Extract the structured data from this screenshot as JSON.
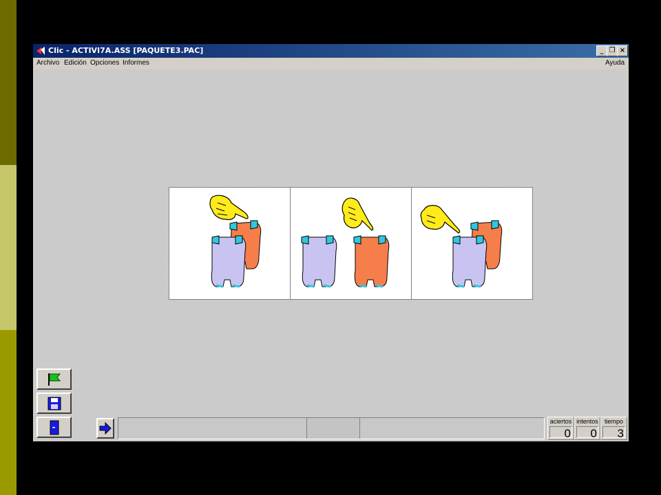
{
  "window": {
    "title": "Clic - ACTIVI7A.ASS [PAQUETE3.PAC]",
    "controls": {
      "minimize": "_",
      "maximize": "❐",
      "close": "×"
    }
  },
  "menu": {
    "items": [
      "Archivo",
      "Edición",
      "Opciones",
      "Informes"
    ],
    "help": "Ayuda"
  },
  "activity": {
    "panels": [
      {
        "image": "hand-pointing-orange-elephant-behind-purple"
      },
      {
        "image": "hand-pointing-between-purple-and-orange-elephants"
      },
      {
        "image": "hand-pointing-purple-elephant-in-front-of-orange"
      }
    ]
  },
  "side_buttons": [
    "green-flag-icon",
    "save-disk-icon",
    "exit-door-icon"
  ],
  "nav": {
    "next_icon": "arrow-right-icon"
  },
  "counters": {
    "aciertos": {
      "label": "aciertos",
      "value": "0"
    },
    "intentos": {
      "label": "intentos",
      "value": "0"
    },
    "tiempo": {
      "label": "tiempo",
      "value": "3"
    }
  },
  "colors": {
    "title_start": "#0a246a",
    "title_end": "#3a6ea5",
    "elephant_purple": "#c9c3f2",
    "elephant_orange": "#f57e4b",
    "hand_yellow": "#ffeb1a"
  }
}
